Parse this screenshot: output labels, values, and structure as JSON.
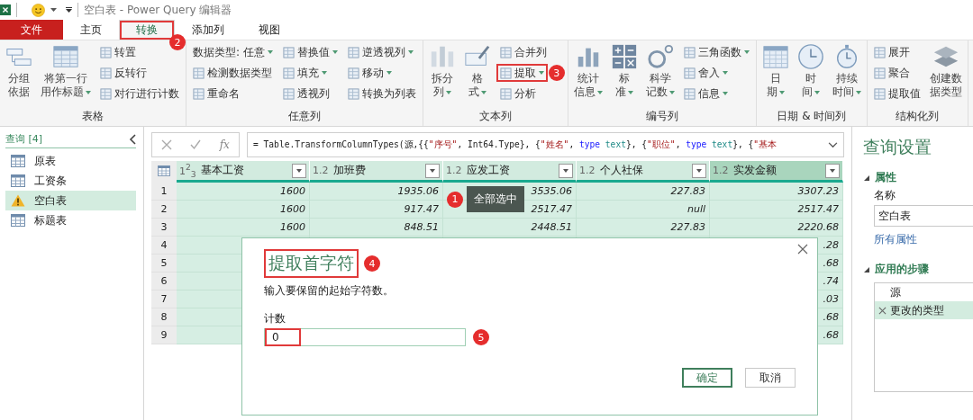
{
  "title_bar": {
    "title": "空白表 - Power Query 编辑器"
  },
  "tabs": [
    {
      "label": "文件",
      "kind": "file",
      "selected": false,
      "highlighted": false
    },
    {
      "label": "主页",
      "kind": "tab",
      "selected": false,
      "highlighted": false
    },
    {
      "label": "转换",
      "kind": "tab",
      "selected": true,
      "highlighted": true,
      "annotation": "2"
    },
    {
      "label": "添加列",
      "kind": "tab",
      "selected": false,
      "highlighted": false
    },
    {
      "label": "视图",
      "kind": "tab",
      "selected": false,
      "highlighted": false
    }
  ],
  "ribbon": {
    "groups": [
      {
        "label": "表格",
        "columns": [
          {
            "kind": "large",
            "lines": [
              "分组",
              "依据"
            ],
            "dropdown": false
          },
          {
            "kind": "large",
            "lines": [
              "将第一行",
              "用作标题"
            ],
            "dropdown": true
          },
          {
            "kind": "stack",
            "items": [
              {
                "label": "转置",
                "dropdown": false,
                "highlighted": false
              },
              {
                "label": "反转行",
                "dropdown": false,
                "highlighted": false
              },
              {
                "label": "对行进行计数",
                "dropdown": false,
                "highlighted": false
              }
            ]
          }
        ]
      },
      {
        "label": "任意列",
        "columns": [
          {
            "kind": "stack",
            "items": [
              {
                "label": "数据类型: 任意",
                "dropdown": true,
                "highlighted": false
              },
              {
                "label": "检测数据类型",
                "dropdown": false,
                "highlighted": false
              },
              {
                "label": "重命名",
                "dropdown": false,
                "highlighted": false
              }
            ]
          },
          {
            "kind": "stack",
            "items": [
              {
                "label": "替换值",
                "dropdown": true,
                "highlighted": false
              },
              {
                "label": "填充",
                "dropdown": true,
                "highlighted": false
              },
              {
                "label": "透视列",
                "dropdown": false,
                "highlighted": false
              }
            ]
          },
          {
            "kind": "stack",
            "items": [
              {
                "label": "逆透视列",
                "dropdown": true,
                "highlighted": false
              },
              {
                "label": "移动",
                "dropdown": true,
                "highlighted": false
              },
              {
                "label": "转换为列表",
                "dropdown": false,
                "highlighted": false
              }
            ]
          }
        ]
      },
      {
        "label": "文本列",
        "columns": [
          {
            "kind": "large",
            "lines": [
              "拆分",
              "列"
            ],
            "dropdown": true
          },
          {
            "kind": "large",
            "lines": [
              "格",
              "式"
            ],
            "dropdown": true
          },
          {
            "kind": "stack",
            "items": [
              {
                "label": "合并列",
                "dropdown": false,
                "highlighted": false
              },
              {
                "label": "提取",
                "dropdown": true,
                "highlighted": true,
                "annotation": "3"
              },
              {
                "label": "分析",
                "dropdown": false,
                "highlighted": false
              }
            ]
          }
        ]
      },
      {
        "label": "编号列",
        "columns": [
          {
            "kind": "large",
            "lines": [
              "统计",
              "信息"
            ],
            "dropdown": true
          },
          {
            "kind": "large",
            "lines": [
              "标",
              "准"
            ],
            "dropdown": true
          },
          {
            "kind": "large",
            "lines": [
              "科学",
              "记数"
            ],
            "dropdown": true
          },
          {
            "kind": "stack",
            "items": [
              {
                "label": "三角函数",
                "dropdown": true,
                "highlighted": false
              },
              {
                "label": "舍入",
                "dropdown": true,
                "highlighted": false
              },
              {
                "label": "信息",
                "dropdown": true,
                "highlighted": false
              }
            ]
          }
        ]
      },
      {
        "label": "日期 & 时间列",
        "columns": [
          {
            "kind": "large",
            "lines": [
              "日",
              "期"
            ],
            "dropdown": true
          },
          {
            "kind": "large",
            "lines": [
              "时",
              "间"
            ],
            "dropdown": true
          },
          {
            "kind": "large",
            "lines": [
              "持续",
              "时间"
            ],
            "dropdown": true
          }
        ]
      },
      {
        "label": "结构化列",
        "columns": [
          {
            "kind": "stack",
            "items": [
              {
                "label": "展开",
                "dropdown": false,
                "highlighted": false
              },
              {
                "label": "聚合",
                "dropdown": false,
                "highlighted": false
              },
              {
                "label": "提取值",
                "dropdown": false,
                "highlighted": false
              }
            ]
          },
          {
            "kind": "large",
            "lines": [
              "创建数",
              "据类型"
            ],
            "dropdown": false
          }
        ]
      }
    ]
  },
  "queries": {
    "header": "查询 [4]",
    "items": [
      {
        "label": "原表",
        "kind": "table",
        "selected": false
      },
      {
        "label": "工资条",
        "kind": "table",
        "selected": false
      },
      {
        "label": "空白表",
        "kind": "warning",
        "selected": true
      },
      {
        "label": "标题表",
        "kind": "table",
        "selected": false
      }
    ]
  },
  "formula_bar": {
    "fx": "fx",
    "tokens": [
      {
        "text": "= Table.TransformColumnTypes(源,{{",
        "kind": "plain"
      },
      {
        "text": "\"序号\"",
        "kind": "string"
      },
      {
        "text": ", Int64.Type}, {",
        "kind": "plain"
      },
      {
        "text": "\"姓名\"",
        "kind": "string"
      },
      {
        "text": ", ",
        "kind": "plain"
      },
      {
        "text": "type",
        "kind": "keyword"
      },
      {
        "text": " text",
        "kind": "typename"
      },
      {
        "text": "}, {",
        "kind": "plain"
      },
      {
        "text": "\"职位\"",
        "kind": "string"
      },
      {
        "text": ", ",
        "kind": "plain"
      },
      {
        "text": "type",
        "kind": "keyword"
      },
      {
        "text": " text",
        "kind": "typename"
      },
      {
        "text": "}, {",
        "kind": "plain"
      },
      {
        "text": "\"基本",
        "kind": "string"
      }
    ]
  },
  "table": {
    "columns": [
      {
        "type": "1$^{2}$$_{3}$",
        "name": "基本工资",
        "selected": true,
        "current": false
      },
      {
        "type": "1.2",
        "name": "加班费",
        "selected": true,
        "current": false
      },
      {
        "type": "1.2",
        "name": "应发工资",
        "selected": true,
        "current": false
      },
      {
        "type": "1.2",
        "name": "个人社保",
        "selected": true,
        "current": false
      },
      {
        "type": "1.2",
        "name": "实发金额",
        "selected": true,
        "current": true
      }
    ],
    "rows": [
      {
        "number": "1",
        "cells": [
          "1600",
          "1935.06",
          "3535.06",
          "227.83",
          "3307.23"
        ]
      },
      {
        "number": "2",
        "cells": [
          "1600",
          "917.47",
          "2517.47",
          "null",
          "2517.47"
        ]
      },
      {
        "number": "3",
        "cells": [
          "1600",
          "848.51",
          "2448.51",
          "227.83",
          "2220.68"
        ]
      },
      {
        "number": "4",
        "cells": [
          null,
          null,
          null,
          null,
          ".28"
        ]
      },
      {
        "number": "5",
        "cells": [
          null,
          null,
          null,
          null,
          ".68"
        ]
      },
      {
        "number": "6",
        "cells": [
          null,
          null,
          null,
          null,
          ".74"
        ]
      },
      {
        "number": "7",
        "cells": [
          null,
          null,
          null,
          null,
          ".03"
        ]
      },
      {
        "number": "8",
        "cells": [
          null,
          null,
          null,
          null,
          ".68"
        ]
      },
      {
        "number": "9",
        "cells": [
          null,
          null,
          null,
          null,
          ".68"
        ]
      }
    ],
    "tooltip": {
      "text": "全部选中",
      "annotation": "1"
    }
  },
  "dialog": {
    "title": "提取首字符",
    "title_highlighted": true,
    "title_annotation": "4",
    "description": "输入要保留的起始字符数。",
    "field": {
      "label": "计数",
      "value": "0",
      "highlighted": true,
      "annotation": "5"
    },
    "buttons": [
      {
        "label": "确定",
        "primary": true
      },
      {
        "label": "取消",
        "primary": false
      }
    ]
  },
  "settings": {
    "title": "查询设置",
    "properties": {
      "heading": "属性",
      "expanded": true,
      "name_label": "名称",
      "name_value": "空白表",
      "link": "所有属性"
    },
    "steps_section": {
      "heading": "应用的步骤",
      "expanded": true,
      "steps": [
        {
          "label": "源",
          "selected": false
        },
        {
          "label": "更改的类型",
          "selected": true
        }
      ]
    }
  }
}
